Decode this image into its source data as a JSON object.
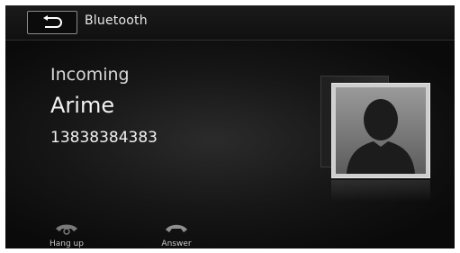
{
  "header": {
    "title": "Bluetooth",
    "back_icon": "back-arrow-icon"
  },
  "call": {
    "status": "Incoming",
    "caller_name": "Arime",
    "caller_number": "13838384383"
  },
  "avatar": {
    "icon": "contact-silhouette-icon"
  },
  "actions": {
    "hangup": {
      "label": "Hang up",
      "icon": "phone-hangup-icon"
    },
    "answer": {
      "label": "Answer",
      "icon": "phone-answer-icon"
    }
  },
  "colors": {
    "background": "#111111",
    "text": "#f0f0f0",
    "border": "#8a8a8a"
  }
}
